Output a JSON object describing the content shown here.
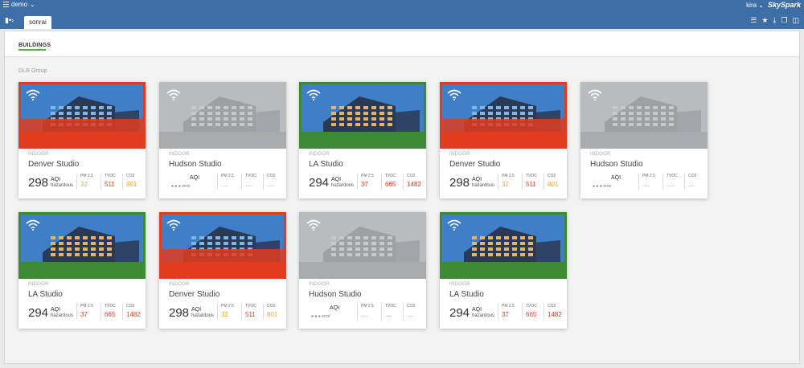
{
  "app": {
    "name": "demo",
    "user": "kira",
    "brand": "SkySpark"
  },
  "tabs": [
    {
      "label": "sonrai"
    }
  ],
  "page": {
    "title": "BUILDINGS",
    "group": "DLR Group"
  },
  "colors": {
    "hazardous": "#e03c1f",
    "good": "#2f7d3a",
    "yellow": "#e5a72a",
    "red": "#e03c1f"
  },
  "cards": [
    {
      "type": "indoor",
      "name": "Denver Studio",
      "aqi": "298",
      "aqi_label": "AQI",
      "status": "hazardous",
      "pm": "32",
      "tvoc": "511",
      "co2": "801",
      "state": "alert"
    },
    {
      "type": "indoor",
      "name": "Hudson Studio",
      "aqi": "",
      "aqi_label": "AQI",
      "status": "error",
      "pm": "....",
      "tvoc": "....",
      "co2": "....",
      "state": "offline"
    },
    {
      "type": "indoor",
      "name": "LA Studio",
      "aqi": "294",
      "aqi_label": "AQI",
      "status": "hazardous",
      "pm": "37",
      "tvoc": "665",
      "co2": "1482",
      "state": "ok"
    },
    {
      "type": "indoor",
      "name": "Denver Studio",
      "aqi": "298",
      "aqi_label": "AQI",
      "status": "hazardous",
      "pm": "32",
      "tvoc": "511",
      "co2": "801",
      "state": "alert"
    },
    {
      "type": "indoor",
      "name": "Hudson Studio",
      "aqi": "",
      "aqi_label": "AQI",
      "status": "error",
      "pm": "....",
      "tvoc": "....",
      "co2": "....",
      "state": "offline"
    },
    {
      "type": "indoor",
      "name": "LA Studio",
      "aqi": "294",
      "aqi_label": "AQI",
      "status": "hazardous",
      "pm": "37",
      "tvoc": "665",
      "co2": "1482",
      "state": "ok"
    },
    {
      "type": "indoor",
      "name": "Denver Studio",
      "aqi": "298",
      "aqi_label": "AQI",
      "status": "hazardous",
      "pm": "32",
      "tvoc": "511",
      "co2": "801",
      "state": "alert"
    },
    {
      "type": "indoor",
      "name": "Hudson Studio",
      "aqi": "",
      "aqi_label": "AQI",
      "status": "error",
      "pm": "....",
      "tvoc": "....",
      "co2": "....",
      "state": "offline"
    },
    {
      "type": "indoor",
      "name": "LA Studio",
      "aqi": "294",
      "aqi_label": "AQI",
      "status": "hazardous",
      "pm": "37",
      "tvoc": "665",
      "co2": "1482",
      "state": "ok"
    }
  ],
  "metric_labels": {
    "pm": "PM 2.5",
    "tvoc": "TVOC",
    "co2": "CO2"
  },
  "type_label": "INDOOR"
}
